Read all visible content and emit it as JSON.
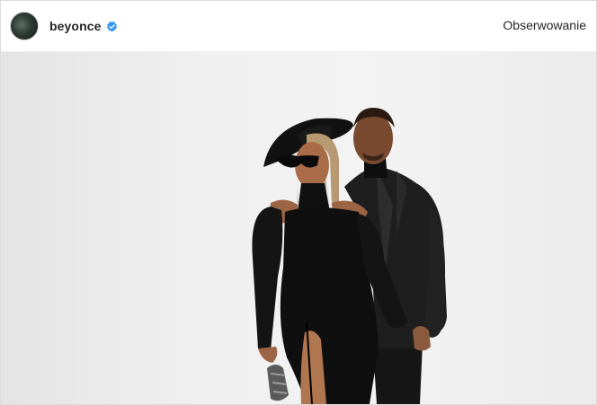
{
  "post": {
    "username": "beyonce",
    "verified": true,
    "follow_label": "Obserwowanie",
    "avatar_icon": "profile-avatar",
    "verified_icon": "verified-badge-icon",
    "accent_color": "#3897f0"
  }
}
